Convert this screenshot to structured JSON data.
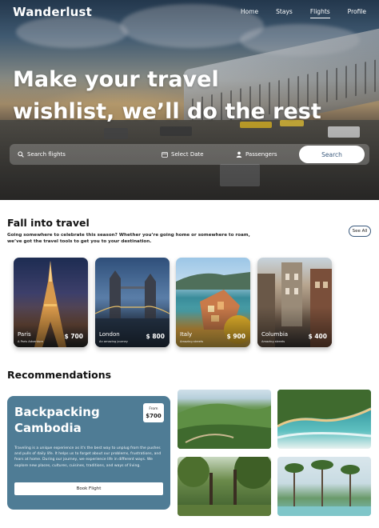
{
  "brand": "Wanderlust",
  "nav": [
    {
      "label": "Home",
      "active": false
    },
    {
      "label": "Stays",
      "active": false
    },
    {
      "label": "Flights",
      "active": true
    },
    {
      "label": "Profile",
      "active": false
    }
  ],
  "hero": {
    "title": "Make your travel\nwishlist, we’ll do the rest"
  },
  "search": {
    "flights_placeholder": "Search flights",
    "date_placeholder": "Select Date",
    "passengers_placeholder": "Passengers",
    "button_label": "Search"
  },
  "fall": {
    "title": "Fall into travel",
    "description": "Going somewhere to celebrate this season? Whether you’re going home or somewhere to roam, we’ve got the travel tools to get you to your destination.",
    "see_all_label": "See All",
    "cards": [
      {
        "city": "Paris",
        "subtitle": "A Paris Adventure",
        "price": "$ 700"
      },
      {
        "city": "London",
        "subtitle": "An amazing journey",
        "price": "$ 800"
      },
      {
        "city": "Italy",
        "subtitle": "Amazing streets",
        "price": "$ 900"
      },
      {
        "city": "Columbia",
        "subtitle": "Amazing streets",
        "price": "$ 400"
      }
    ]
  },
  "recommendations": {
    "title": "Recommendations",
    "feature": {
      "title": "Backpacking\nCambodia",
      "price_from": "From",
      "price": "$700",
      "body": "Traveling is a unique experience as it's the best way to unplug from the pushes and pulls of daily life. It helps us to forget about our problems, frustrations, and fears at home. During our journey, we experience life in different ways. We explore new places, cultures, cuisines, traditions, and ways of living.",
      "button_label": "Book Flight"
    }
  },
  "colors": {
    "accent": "#4f7c95",
    "button_text": "#3b5a7d"
  },
  "icons": [
    "search-icon",
    "calendar-icon",
    "user-icon"
  ]
}
